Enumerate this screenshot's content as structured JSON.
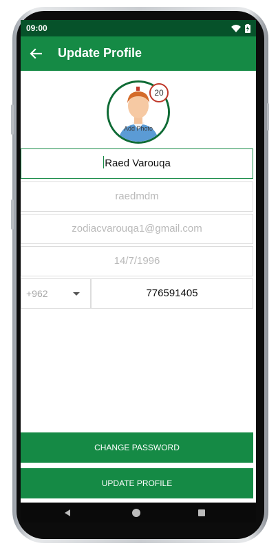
{
  "statusbar": {
    "time": "09:00"
  },
  "appbar": {
    "title": "Update Profile",
    "back_icon": "arrow-left-icon"
  },
  "profile": {
    "add_photo_label": "Add Photo",
    "badge_count": "20"
  },
  "form": {
    "name_value": "Raed Varouqa",
    "username_placeholder": "raedmdm",
    "email_placeholder": "zodiacvarouqa1@gmail.com",
    "birthdate_placeholder": "14/7/1996",
    "country_code": "+962",
    "phone_value": "776591405"
  },
  "buttons": {
    "change_password": "CHANGE PASSWORD",
    "update_profile": "UPDATE PROFILE"
  },
  "colors": {
    "primary": "#158a45",
    "status_bar": "#06522a",
    "badge_border": "#c0392b"
  }
}
